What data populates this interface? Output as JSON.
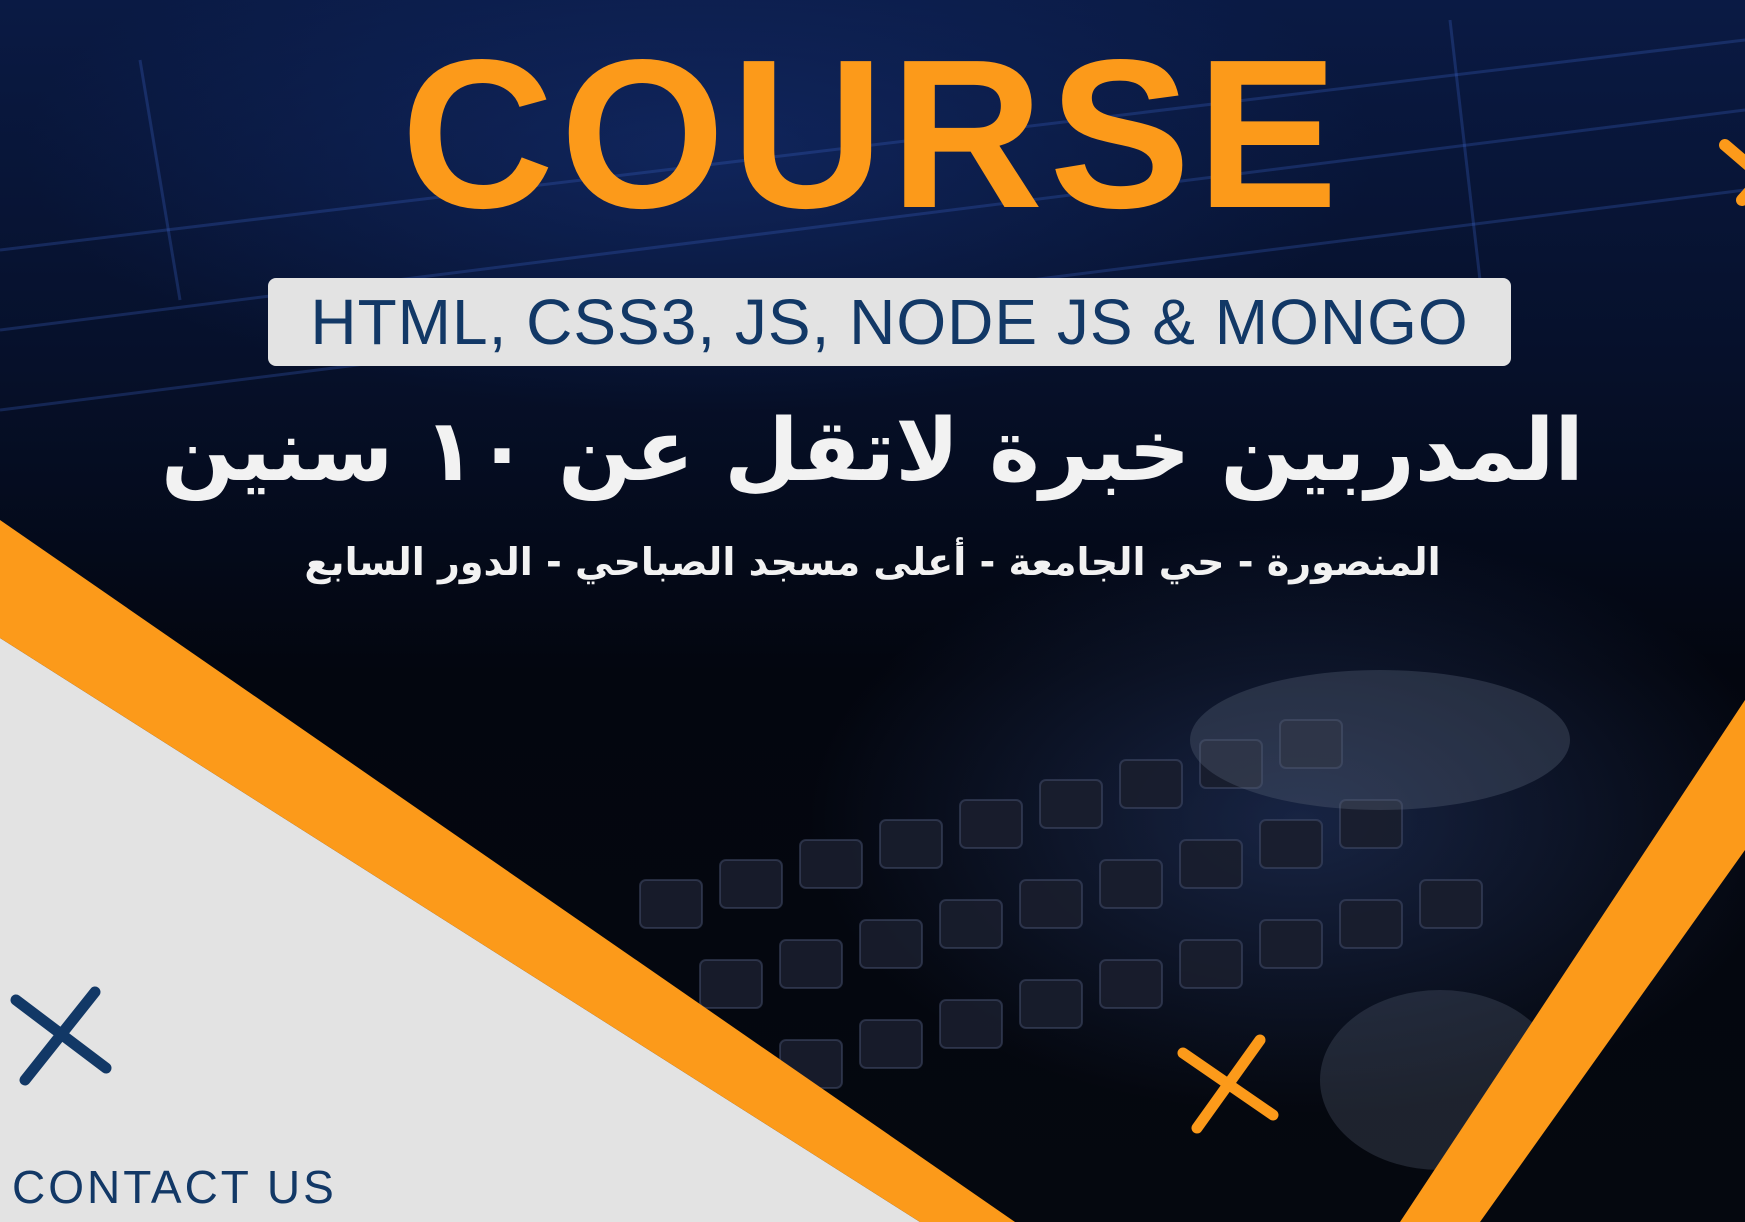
{
  "title": "COURSE",
  "subtitle": "HTML, CSS3, JS, NODE JS & MONGO",
  "headline_ar": "المدربين خبرة لاتقل عن ١٠ سنين",
  "address_ar": "المنصورة - حي الجامعة - أعلى مسجد الصباحي - الدور السابع",
  "contact_label": "CONTACT US",
  "colors": {
    "accent_orange": "#fc9a1a",
    "navy": "#123866",
    "light_panel": "#e3e3e3",
    "white_text": "#f2f2f2",
    "dark_background": "#04070f"
  },
  "icons": [
    "cross-decoration-icon"
  ]
}
